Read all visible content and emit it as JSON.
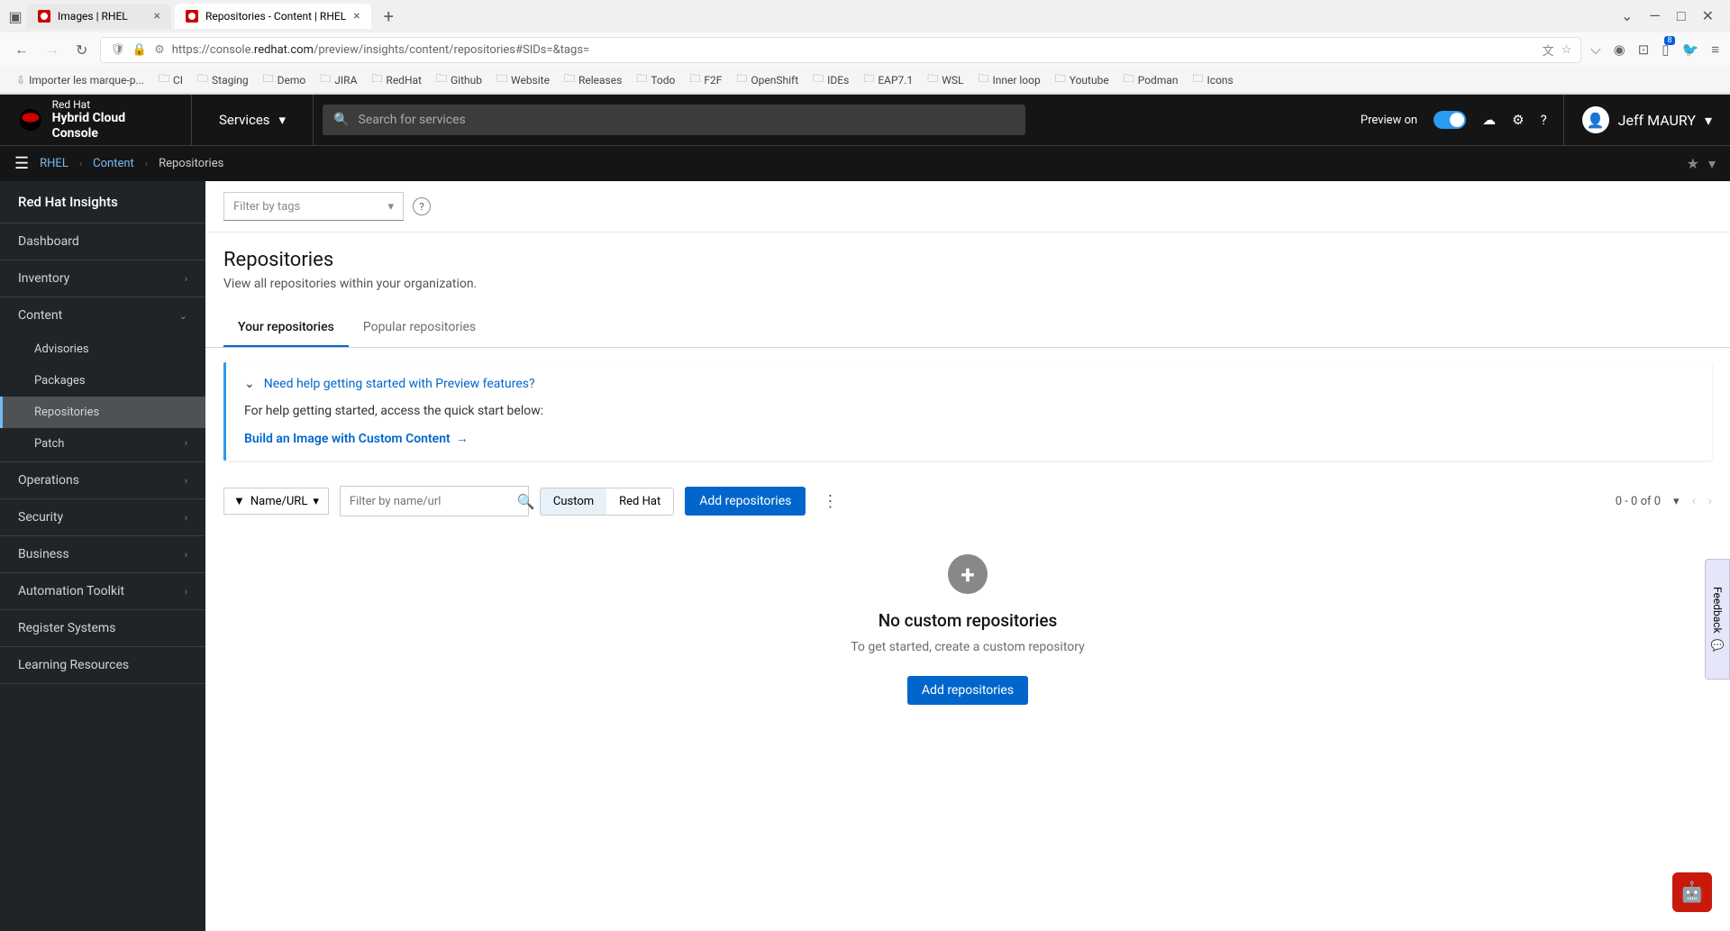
{
  "browser": {
    "tabs": [
      {
        "title": "Images | RHEL",
        "active": false
      },
      {
        "title": "Repositories - Content | RHEL",
        "active": true
      }
    ],
    "url_prefix": "https://console.",
    "url_bold": "redhat.com",
    "url_suffix": "/preview/insights/content/repositories#SIDs=&tags=",
    "bookmarks": [
      "Importer les marque-p...",
      "CI",
      "Staging",
      "Demo",
      "JIRA",
      "RedHat",
      "Github",
      "Website",
      "Releases",
      "Todo",
      "F2F",
      "OpenShift",
      "IDEs",
      "EAP7.1",
      "WSL",
      "Inner loop",
      "Youtube",
      "Podman",
      "Icons"
    ],
    "notification_count": "8"
  },
  "header": {
    "brand_top": "Red Hat",
    "brand_bottom": "Hybrid Cloud Console",
    "services": "Services",
    "search_placeholder": "Search for services",
    "preview_label": "Preview on",
    "user_name": "Jeff MAURY"
  },
  "breadcrumb": {
    "items": [
      "RHEL",
      "Content"
    ],
    "current": "Repositories"
  },
  "sidebar": {
    "title": "Red Hat Insights",
    "items": {
      "dashboard": "Dashboard",
      "inventory": "Inventory",
      "content": "Content",
      "content_subs": {
        "advisories": "Advisories",
        "packages": "Packages",
        "repositories": "Repositories",
        "patch": "Patch"
      },
      "operations": "Operations",
      "security": "Security",
      "business": "Business",
      "automation": "Automation Toolkit",
      "register": "Register Systems",
      "learning": "Learning Resources"
    }
  },
  "main": {
    "filter_tags": "Filter by tags",
    "title": "Repositories",
    "description": "View all repositories within your organization.",
    "tabs": {
      "your": "Your repositories",
      "popular": "Popular repositories"
    },
    "info": {
      "title": "Need help getting started with Preview features?",
      "body": "For help getting started, access the quick start below:",
      "link": "Build an Image with Custom Content"
    },
    "toolbar": {
      "filter_by": "Name/URL",
      "search_placeholder": "Filter by name/url",
      "toggle_custom": "Custom",
      "toggle_redhat": "Red Hat",
      "add_btn": "Add repositories",
      "pagination": "0 - 0 of 0"
    },
    "empty": {
      "title": "No custom repositories",
      "desc": "To get started, create a custom repository",
      "btn": "Add repositories"
    }
  },
  "feedback": "Feedback"
}
